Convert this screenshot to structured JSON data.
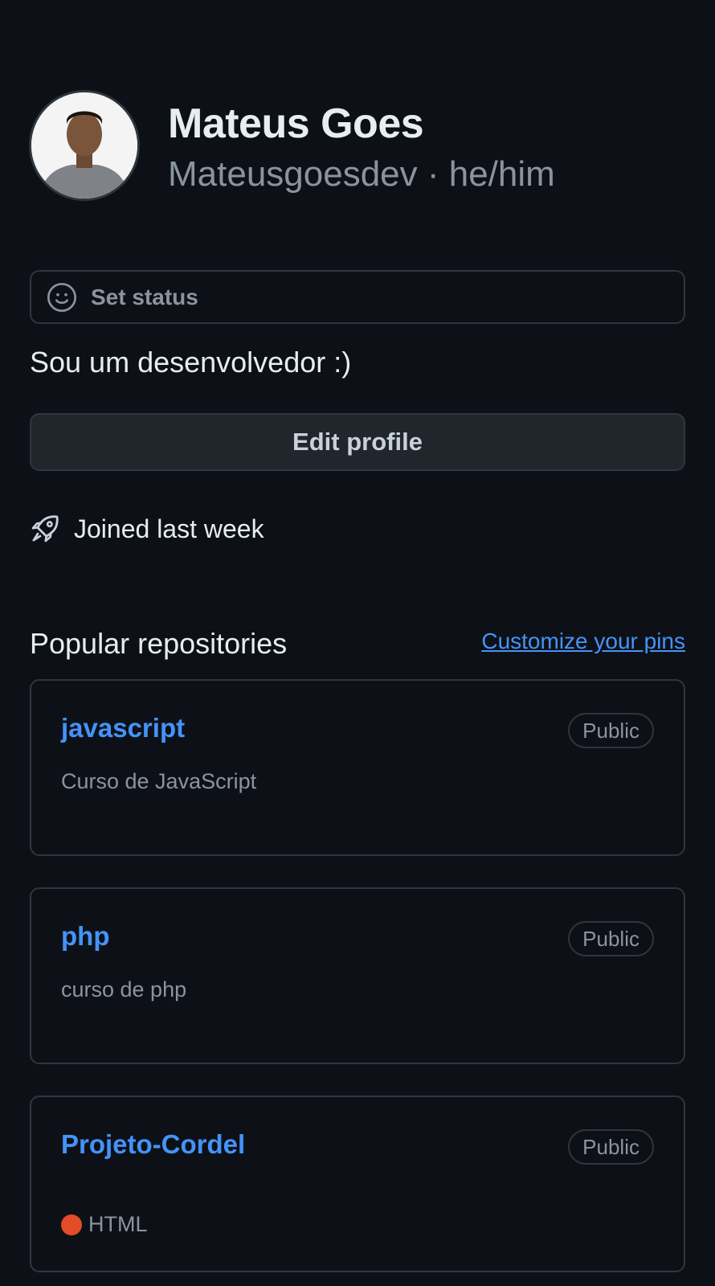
{
  "profile": {
    "display_name": "Mateus Goes",
    "username_line": "Mateusgoesdev · he/him",
    "bio": "Sou um desenvolvedor :)",
    "joined": "Joined last week"
  },
  "status": {
    "label": "Set status",
    "icon": "smiley-icon"
  },
  "actions": {
    "edit_profile": "Edit profile"
  },
  "repos_section": {
    "title": "Popular repositories",
    "customize_link": "Customize your pins",
    "repos": [
      {
        "name": "javascript",
        "visibility": "Public",
        "description": "Curso de JavaScript",
        "language": ""
      },
      {
        "name": "php",
        "visibility": "Public",
        "description": "curso de php",
        "language": ""
      },
      {
        "name": "Projeto-Cordel",
        "visibility": "Public",
        "description": "",
        "language": "HTML",
        "language_color": "#e34c26"
      }
    ]
  },
  "colors": {
    "background": "#0d1117",
    "border": "#30363d",
    "link": "#4493f8",
    "muted": "#8b949e"
  }
}
